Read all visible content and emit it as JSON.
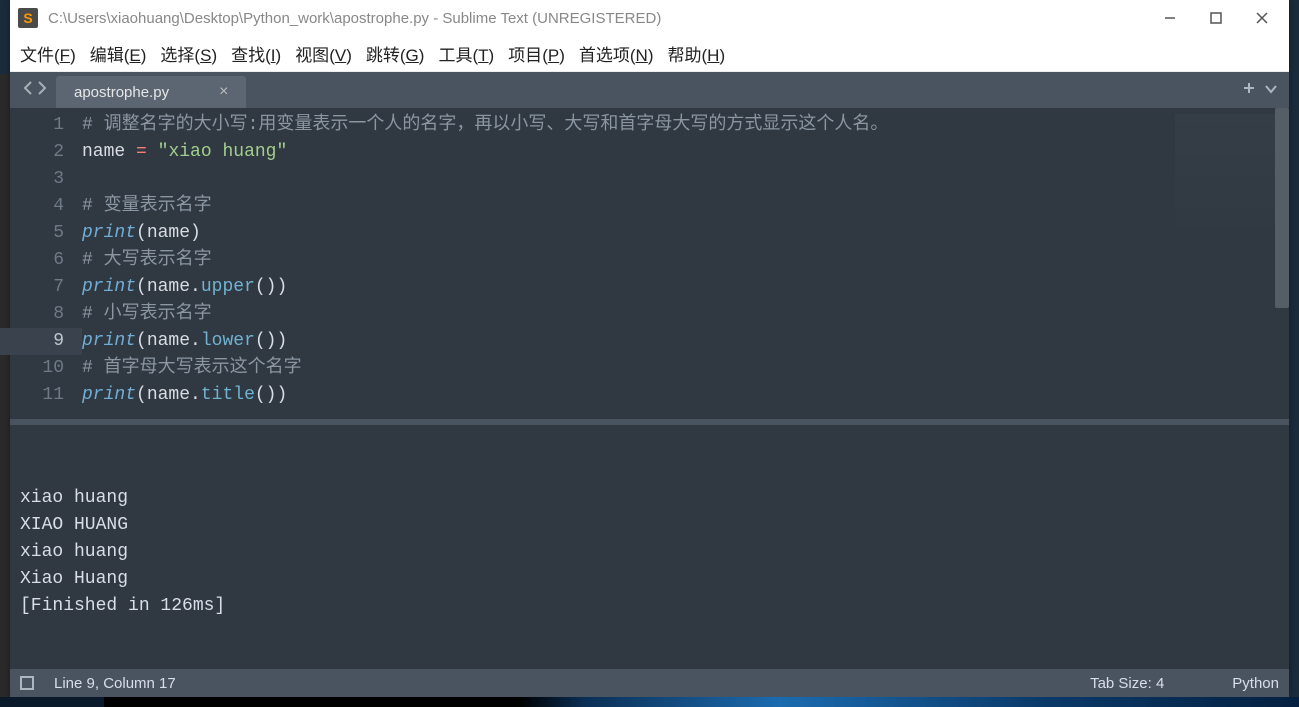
{
  "window": {
    "title": "C:\\Users\\xiaohuang\\Desktop\\Python_work\\apostrophe.py - Sublime Text (UNREGISTERED)"
  },
  "menu": {
    "file": {
      "label": "文件",
      "key": "F"
    },
    "edit": {
      "label": "编辑",
      "key": "E"
    },
    "select": {
      "label": "选择",
      "key": "S"
    },
    "find": {
      "label": "查找",
      "key": "I"
    },
    "view": {
      "label": "视图",
      "key": "V"
    },
    "goto": {
      "label": "跳转",
      "key": "G"
    },
    "tools": {
      "label": "工具",
      "key": "T"
    },
    "project": {
      "label": "项目",
      "key": "P"
    },
    "prefs": {
      "label": "首选项",
      "key": "N"
    },
    "help": {
      "label": "帮助",
      "key": "H"
    }
  },
  "tab": {
    "label": "apostrophe.py"
  },
  "code": {
    "active_line": 9,
    "lines": [
      {
        "n": 1,
        "tokens": [
          {
            "c": "cm-comment",
            "t": "# 调整名字的大小写:用变量表示一个人的名字，再以小写、大写和首字母大写的方式显示这个人名。"
          }
        ]
      },
      {
        "n": 2,
        "tokens": [
          {
            "c": "cm-var",
            "t": "name"
          },
          {
            "c": "cm-punc",
            "t": " "
          },
          {
            "c": "cm-op",
            "t": "="
          },
          {
            "c": "cm-punc",
            "t": " "
          },
          {
            "c": "cm-str",
            "t": "\"xiao huang\""
          }
        ]
      },
      {
        "n": 3,
        "tokens": []
      },
      {
        "n": 4,
        "tokens": [
          {
            "c": "cm-comment",
            "t": "# 变量表示名字"
          }
        ]
      },
      {
        "n": 5,
        "tokens": [
          {
            "c": "cm-builtin",
            "t": "print"
          },
          {
            "c": "cm-punc",
            "t": "("
          },
          {
            "c": "cm-var",
            "t": "name"
          },
          {
            "c": "cm-punc",
            "t": ")"
          }
        ]
      },
      {
        "n": 6,
        "tokens": [
          {
            "c": "cm-comment",
            "t": "# 大写表示名字"
          }
        ]
      },
      {
        "n": 7,
        "tokens": [
          {
            "c": "cm-builtin",
            "t": "print"
          },
          {
            "c": "cm-punc",
            "t": "("
          },
          {
            "c": "cm-var",
            "t": "name"
          },
          {
            "c": "cm-punc",
            "t": "."
          },
          {
            "c": "cm-method",
            "t": "upper"
          },
          {
            "c": "cm-punc",
            "t": "())"
          }
        ]
      },
      {
        "n": 8,
        "tokens": [
          {
            "c": "cm-comment",
            "t": "# 小写表示名字"
          }
        ]
      },
      {
        "n": 9,
        "tokens": [
          {
            "c": "cm-builtin",
            "t": "print"
          },
          {
            "c": "cm-punc",
            "t": "("
          },
          {
            "c": "cm-var",
            "t": "name"
          },
          {
            "c": "cm-punc",
            "t": "."
          },
          {
            "c": "cm-method",
            "t": "lower"
          },
          {
            "c": "cm-punc",
            "t": "())"
          }
        ]
      },
      {
        "n": 10,
        "tokens": [
          {
            "c": "cm-comment",
            "t": "# 首字母大写表示这个名字"
          }
        ]
      },
      {
        "n": 11,
        "tokens": [
          {
            "c": "cm-builtin",
            "t": "print"
          },
          {
            "c": "cm-punc",
            "t": "("
          },
          {
            "c": "cm-var",
            "t": "name"
          },
          {
            "c": "cm-punc",
            "t": "."
          },
          {
            "c": "cm-method",
            "t": "title"
          },
          {
            "c": "cm-punc",
            "t": "())"
          }
        ]
      }
    ]
  },
  "output": {
    "lines": [
      "xiao huang",
      "XIAO HUANG",
      "xiao huang",
      "Xiao Huang",
      "[Finished in 126ms]"
    ]
  },
  "status": {
    "position": "Line 9, Column 17",
    "tab_size": "Tab Size: 4",
    "syntax": "Python"
  }
}
